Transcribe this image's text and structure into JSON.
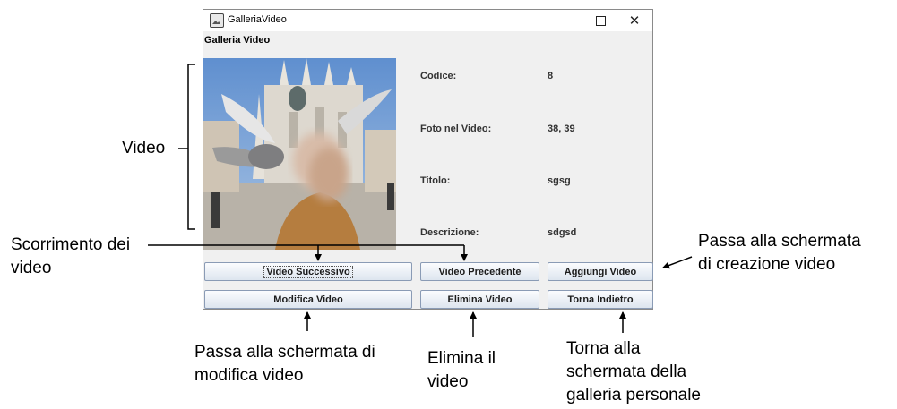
{
  "window": {
    "title": "GalleriaVideo",
    "heading": "Galleria Video"
  },
  "icons": [
    "app-icon",
    "minimize-icon",
    "maximize-icon",
    "close-icon"
  ],
  "details": {
    "code_label": "Codice:",
    "code_value": "8",
    "photos_label": "Foto nel Video:",
    "photos_value": "38, 39",
    "title_label": "Titolo:",
    "title_value": "sgsg",
    "description_label": "Descrizione:",
    "description_value": "sdgsd"
  },
  "buttons": {
    "next": "Video Successivo",
    "previous": "Video Precedente",
    "add": "Aggiungi Video",
    "edit": "Modifica Video",
    "delete": "Elimina Video",
    "back": "Torna Indietro"
  },
  "annotations": {
    "video": "Video",
    "scroll": [
      "Scorrimento dei",
      "video"
    ],
    "create": [
      "Passa alla schermata",
      "di creazione video"
    ],
    "edit": [
      "Passa alla schermata di",
      "modifica video"
    ],
    "delete": [
      "Elimina il",
      "video"
    ],
    "back": [
      "Torna alla",
      "schermata della",
      "galleria personale"
    ]
  },
  "colors": {
    "window_bg": "#f0f0f0",
    "button_border": "#8a9bb5",
    "sky": "#7fa8d6"
  }
}
